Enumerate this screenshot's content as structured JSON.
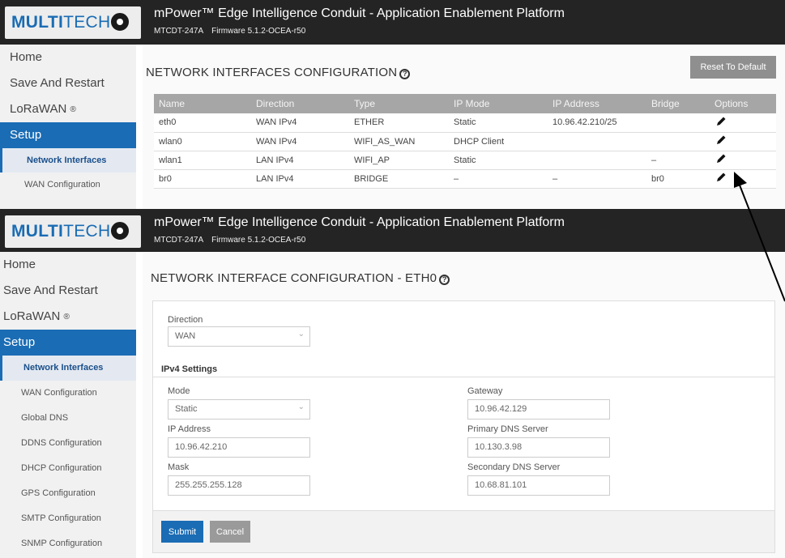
{
  "brand": {
    "logo_bold": "MULTI",
    "logo_thin": "TECH",
    "brand_color": "#1a6cb4"
  },
  "header": {
    "title": "mPower™ Edge Intelligence Conduit - Application Enablement Platform",
    "model": "MTCDT-247A",
    "firmware": "Firmware  5.1.2-OCEA-r50"
  },
  "sidebar1": {
    "items": [
      "Home",
      "Save And Restart",
      "LoRaWAN",
      "Setup"
    ],
    "reg_mark": "®",
    "subitems": [
      "Network Interfaces",
      "WAN Configuration"
    ]
  },
  "sidebar2": {
    "items": [
      "Home",
      "Save And Restart",
      "LoRaWAN",
      "Setup"
    ],
    "reg_mark": "®",
    "subitems": [
      "Network Interfaces",
      "WAN Configuration",
      "Global DNS",
      "DDNS Configuration",
      "DHCP Configuration",
      "GPS Configuration",
      "SMTP Configuration",
      "SNMP Configuration"
    ]
  },
  "list_page": {
    "title": "NETWORK INTERFACES CONFIGURATION",
    "reset_label": "Reset To Default",
    "columns": [
      "Name",
      "Direction",
      "Type",
      "IP Mode",
      "IP Address",
      "Bridge",
      "Options"
    ],
    "rows": [
      {
        "name": "eth0",
        "direction": "WAN IPv4",
        "type": "ETHER",
        "ip_mode": "Static",
        "ip_address": "10.96.42.210/25",
        "bridge": ""
      },
      {
        "name": "wlan0",
        "direction": "WAN IPv4",
        "type": "WIFI_AS_WAN",
        "ip_mode": "DHCP Client",
        "ip_address": "",
        "bridge": ""
      },
      {
        "name": "wlan1",
        "direction": "LAN IPv4",
        "type": "WIFI_AP",
        "ip_mode": "Static",
        "ip_address": "",
        "bridge": "–"
      },
      {
        "name": "br0",
        "direction": "LAN IPv4",
        "type": "BRIDGE",
        "ip_mode": "–",
        "ip_address": "–",
        "bridge": "br0"
      }
    ]
  },
  "form_page": {
    "title": "NETWORK INTERFACE CONFIGURATION - ETH0",
    "direction_label": "Direction",
    "direction_value": "WAN",
    "ipv4_section": "IPv4 Settings",
    "mode_label": "Mode",
    "mode_value": "Static",
    "ip_label": "IP Address",
    "ip_value": "10.96.42.210",
    "mask_label": "Mask",
    "mask_value": "255.255.255.128",
    "gateway_label": "Gateway",
    "gateway_value": "10.96.42.129",
    "pdns_label": "Primary DNS Server",
    "pdns_value": "10.130.3.98",
    "sdns_label": "Secondary DNS Server",
    "sdns_value": "10.68.81.101",
    "submit_label": "Submit",
    "cancel_label": "Cancel"
  },
  "icons": {
    "edit": "pencil-icon",
    "help": "help-circle-icon",
    "annotation": "arrow-annotation"
  }
}
